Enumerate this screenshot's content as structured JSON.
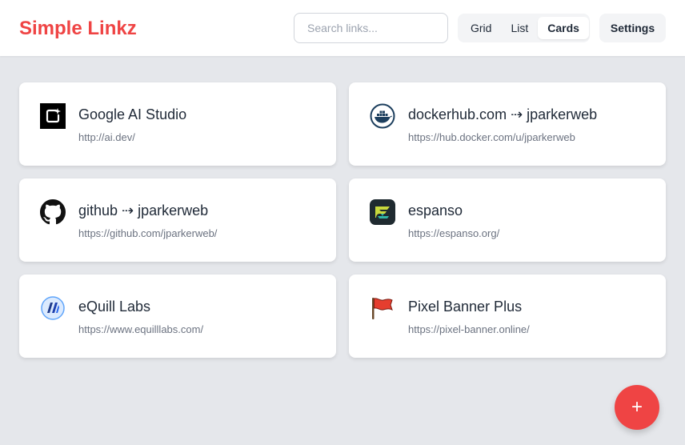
{
  "app": {
    "title": "Simple Linkz"
  },
  "search": {
    "placeholder": "Search links..."
  },
  "view_toggle": {
    "options": [
      "Grid",
      "List",
      "Cards"
    ],
    "selected": "Cards"
  },
  "settings": {
    "label": "Settings"
  },
  "links": [
    {
      "title": "Google AI Studio",
      "url": "http://ai.dev/",
      "icon": "google-ai-studio-icon"
    },
    {
      "title": "dockerhub.com ⇢ jparkerweb",
      "url": "https://hub.docker.com/u/jparkerweb",
      "icon": "docker-icon"
    },
    {
      "title": "github ⇢ jparkerweb",
      "url": "https://github.com/jparkerweb/",
      "icon": "github-icon"
    },
    {
      "title": "espanso",
      "url": "https://espanso.org/",
      "icon": "espanso-icon"
    },
    {
      "title": "eQuill Labs",
      "url": "https://www.equilllabs.com/",
      "icon": "equill-icon"
    },
    {
      "title": "Pixel Banner Plus",
      "url": "https://pixel-banner.online/",
      "icon": "flag-icon"
    }
  ],
  "fab": {
    "label": "+"
  },
  "colors": {
    "brand": "#ef4444",
    "background": "#e5e7eb"
  }
}
